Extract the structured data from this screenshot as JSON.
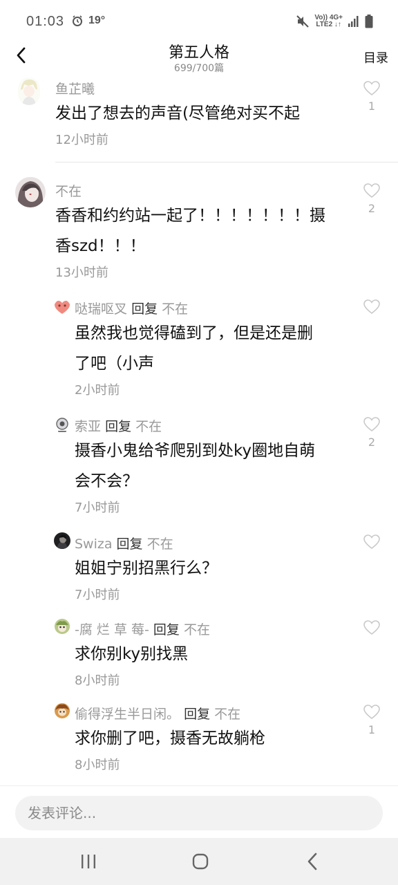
{
  "status_bar": {
    "time": "01:03",
    "temperature": "19°",
    "network_top": "Vo)) 4G+",
    "network_bottom": "LTE2 ↓↑"
  },
  "header": {
    "title": "第五人格",
    "subtitle": "699/700篇",
    "catalog_label": "目录"
  },
  "comments": [
    {
      "author": "鱼芷曦",
      "text": "发出了想去的声音(尽管绝对买不起",
      "time": "12小时前",
      "likes": "1"
    },
    {
      "author": "不在",
      "text_lines": [
        "香香和约约站一起了！！！！！！！摄",
        "香szd！！！"
      ],
      "time": "13小时前",
      "likes": "2"
    },
    {
      "author": "哒瑞呕叉",
      "reply_word": "回复",
      "reply_to": "不在",
      "text_lines": [
        "虽然我也觉得磕到了，但是还是删",
        "了吧（小声"
      ],
      "time": "2小时前",
      "likes": ""
    },
    {
      "author": "索亚",
      "reply_word": "回复",
      "reply_to": "不在",
      "text_lines": [
        "摄香小鬼给爷爬别到处ky圈地自萌",
        "会不会？"
      ],
      "time": "7小时前",
      "likes": "2"
    },
    {
      "author": "Swiza",
      "reply_word": "回复",
      "reply_to": "不在",
      "text": "姐姐宁别招黑行么？",
      "time": "7小时前",
      "likes": ""
    },
    {
      "author": "-腐 烂 草 莓-",
      "reply_word": "回复",
      "reply_to": "不在",
      "text": "求你别ky别找黑",
      "time": "8小时前",
      "likes": ""
    },
    {
      "author": "偷得浮生半日闲。",
      "reply_word": "回复",
      "reply_to": "不在",
      "text": "求你删了吧，摄香无故躺枪",
      "time": "8小时前",
      "likes": "1"
    }
  ],
  "comment_input": {
    "placeholder": "发表评论..."
  },
  "colors": {
    "muted_text": "#999999",
    "primary_text": "#111111",
    "input_bg": "#f2f2f2",
    "nav_bg": "#f1f1f1"
  },
  "icons": [
    "alarm-icon",
    "mute-icon",
    "signal-icon",
    "battery-icon",
    "back-arrow-icon",
    "heart-icon",
    "recent-apps-icon",
    "home-icon",
    "nav-back-icon"
  ]
}
